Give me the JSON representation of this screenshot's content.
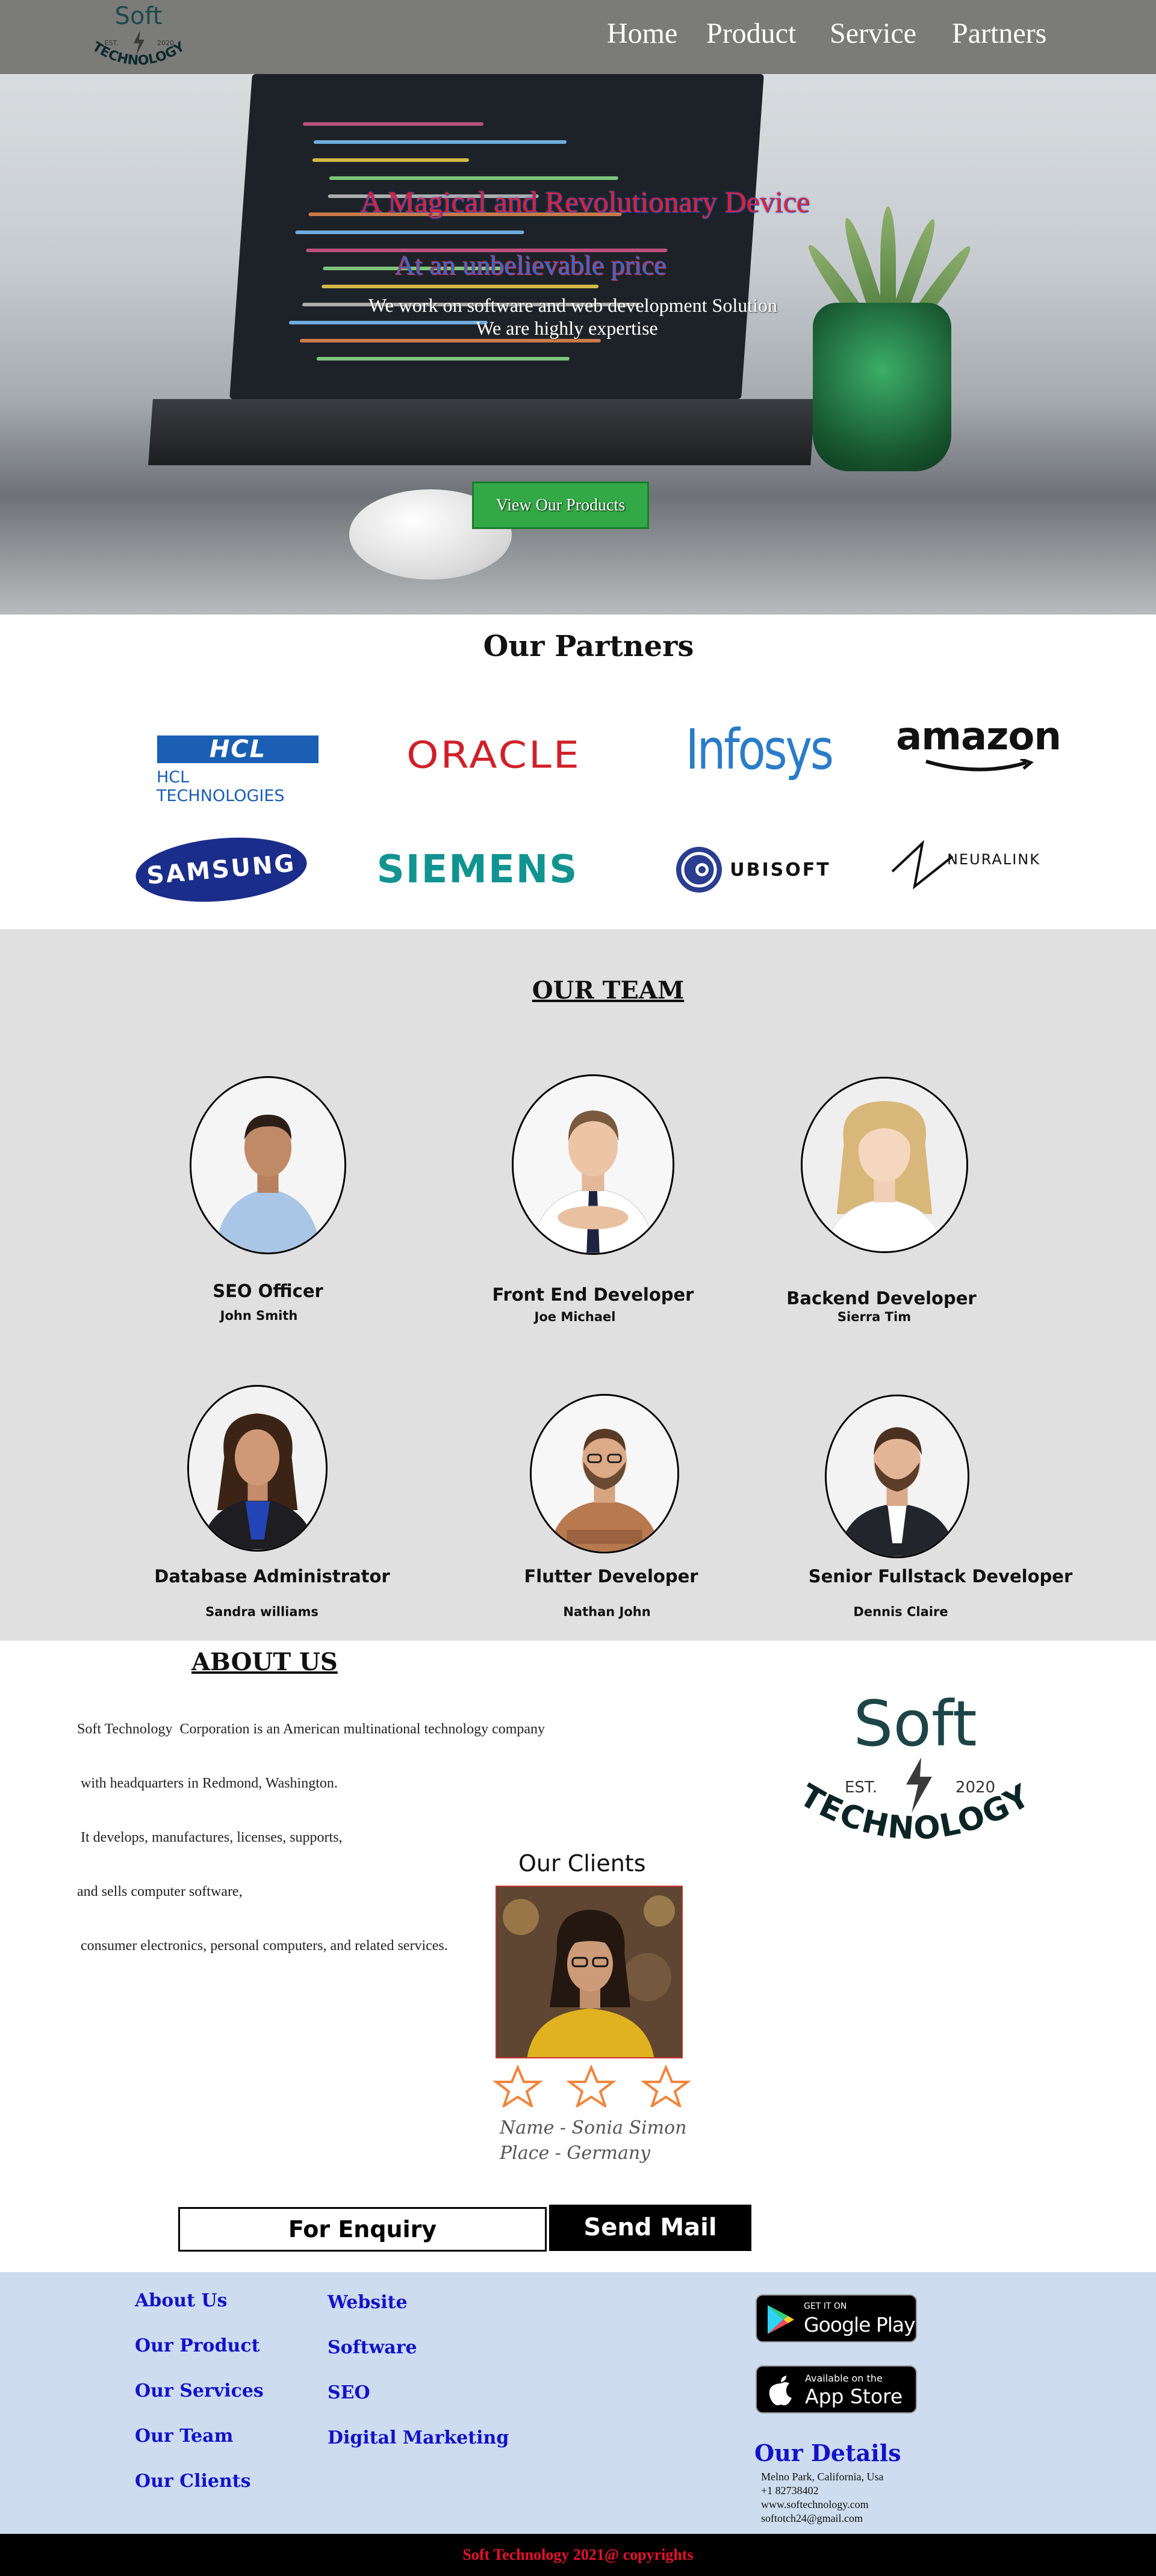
{
  "nav": {
    "logo": {
      "top": "Soft",
      "est": "EST.",
      "year": "2020",
      "bottom": "TECHNOLOGY"
    },
    "links": [
      "Home",
      "Product",
      "Service",
      "Partners"
    ]
  },
  "hero": {
    "headline": "A Magical and Revolutionary Device",
    "subheadline": "At an unbelievable price",
    "line1": "We work on software and web development Solution",
    "line2": "We are highly expertise",
    "button": "View Our Products",
    "colors": {
      "headline": "#e2202f",
      "subheadline": "#2a6fd8",
      "button": "#32a846"
    }
  },
  "partners": {
    "heading": "Our Partners",
    "logos": [
      {
        "name": "HCL",
        "sub": "HCL TECHNOLOGIES"
      },
      {
        "name": "ORACLE"
      },
      {
        "name": "Infosys"
      },
      {
        "name": "amazon"
      },
      {
        "name": "SAMSUNG"
      },
      {
        "name": "SIEMENS"
      },
      {
        "name": "UBISOFT"
      },
      {
        "name": "NEURALINK"
      }
    ]
  },
  "team": {
    "heading": "OUR TEAM",
    "members": [
      {
        "role": "SEO Officer",
        "name": "John Smith"
      },
      {
        "role": "Front End Developer",
        "name": "Joe Michael"
      },
      {
        "role": "Backend Developer",
        "name": "Sierra Tim"
      },
      {
        "role": "Database Administrator",
        "name": "Sandra williams"
      },
      {
        "role": "Flutter Developer",
        "name": "Nathan John"
      },
      {
        "role": "Senior Fullstack Developer",
        "name": "Dennis Claire"
      }
    ]
  },
  "about": {
    "heading": "ABOUT US",
    "lines": [
      "Soft Technology  Corporation is an American multinational technology company",
      " with headquarters in Redmond, Washington.",
      " It develops, manufactures, licenses, supports,",
      "and sells computer software,",
      " consumer electronics, personal computers, and related services."
    ],
    "logo": {
      "top": "Soft",
      "est": "EST.",
      "year": "2020",
      "bottom": "TECHNOLOGY"
    }
  },
  "clients": {
    "heading": "Our Clients",
    "name": "Name - Sonia Simon",
    "place": "Place - Germany",
    "rating_shown": 3
  },
  "enquiry": {
    "label": "For Enquiry",
    "button": "Send Mail"
  },
  "footer": {
    "col1": [
      "About Us",
      "Our Product",
      "Our Services",
      "Our Team",
      "Our Clients"
    ],
    "col2": [
      "Website",
      "Software",
      "SEO",
      "Digital Marketing"
    ],
    "google_play": {
      "small": "GET IT ON",
      "big": "Google Play"
    },
    "app_store": {
      "small": "Available on the",
      "big": "App Store"
    },
    "details_heading": "Our Details",
    "details": [
      "Melno Park, California, Usa",
      "+1 82738402",
      "www.softechnology.com",
      "softotch24@gmail.com"
    ],
    "copyright": "Soft Technology 2021@ copyrights"
  }
}
